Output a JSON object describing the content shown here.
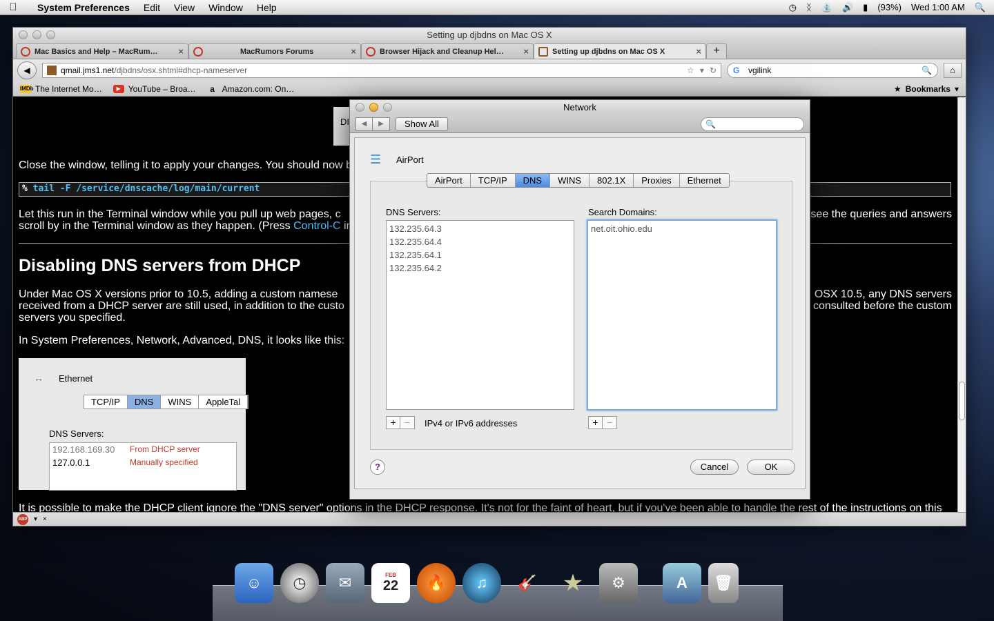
{
  "menubar": {
    "app": "System Preferences",
    "menus": [
      "Edit",
      "View",
      "Window",
      "Help"
    ],
    "battery": "(93%)",
    "clock": "Wed 1:00 AM"
  },
  "browser": {
    "title": "Setting up djbdns on Mac OS X",
    "tabs": [
      {
        "label": "Mac Basics and Help – MacRum…"
      },
      {
        "label": "MacRumors Forums"
      },
      {
        "label": "Browser Hijack and Cleanup Hel…"
      },
      {
        "label": "Setting up djbdns on Mac OS X"
      }
    ],
    "url_host": "qmail.jms1.net",
    "url_path": "/djbdns/osx.shtml#dhcp-nameserver",
    "search_value": "vgilink",
    "bookmarks": [
      "The Internet Mo…",
      "YouTube – Broa…",
      "Amazon.com: On…"
    ],
    "bookmarks_menu": "Bookmarks"
  },
  "page": {
    "p1": "Close the window, telling it to apply your changes. You should now b",
    "terminal_prompt": "%",
    "terminal_cmd": "tail -F /service/dnscache/log/main/current",
    "p2_left": "Let this run in the Terminal window while you pull up web pages, c",
    "p2_right": "see the queries and answers",
    "p2b": "scroll by in the Terminal window as they happen. (Press",
    "p2_link": "Control-C",
    "p2_after": "in",
    "h2": "Disabling DNS servers from DHCP",
    "p3a": "Under Mac OS X versions prior to 10.5, adding a custom namese",
    "p3a_right": "OSX 10.5, any DNS servers",
    "p3b": "received from a DHCP server are still used, in addition to the custo",
    "p3b_right": "consulted before the custom",
    "p3c": "servers you specified.",
    "p4": "In System Preferences, Network, Advanced, DNS, it looks like this:",
    "p5": "It is possible to make the DHCP client ignore the \"DNS server\" options in the DHCP response. It's not for the faint of heart, but if you've been able to handle the rest of the instructions on this",
    "shot": {
      "iface": "Ethernet",
      "tabs": [
        "TCP/IP",
        "DNS",
        "WINS",
        "AppleTal"
      ],
      "dns_label": "DNS Servers:",
      "rows": [
        {
          "ip": "192.168.169.30",
          "src": "From DHCP server"
        },
        {
          "ip": "127.0.0.1",
          "src": "Manually specified"
        }
      ]
    }
  },
  "network": {
    "title": "Network",
    "show_all": "Show All",
    "interface": "AirPort",
    "tabs": [
      "AirPort",
      "TCP/IP",
      "DNS",
      "WINS",
      "802.1X",
      "Proxies",
      "Ethernet"
    ],
    "dns_label": "DNS Servers:",
    "dns_servers": [
      "132.235.64.3",
      "132.235.64.4",
      "132.235.64.1",
      "132.235.64.2"
    ],
    "dns_hint": "IPv4 or IPv6 addresses",
    "search_label": "Search Domains:",
    "search_domains": [
      "net.oit.ohio.edu"
    ],
    "help": "?",
    "cancel": "Cancel",
    "ok": "OK"
  },
  "dock": {
    "calendar_month": "FEB",
    "calendar_day": "22"
  }
}
